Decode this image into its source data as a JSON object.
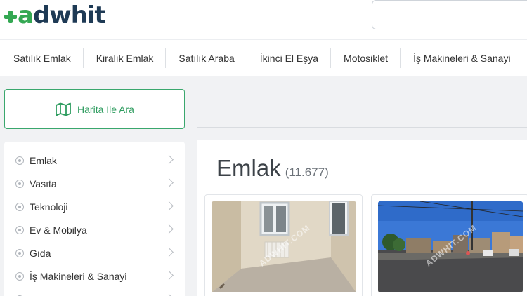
{
  "header": {
    "logo": {
      "accent": "a",
      "rest": "dwhit"
    },
    "search": {
      "placeholder": ""
    }
  },
  "nav": {
    "items": [
      "Satılık Emlak",
      "Kiralık Emlak",
      "Satılık Araba",
      "İkinci El Eşya",
      "Motosiklet",
      "İş Makineleri & Sanayi"
    ]
  },
  "map_button": {
    "label": "Harita Ile Ara",
    "icon": "map-icon"
  },
  "sidebar": {
    "items": [
      {
        "label": "Emlak"
      },
      {
        "label": "Vasıta"
      },
      {
        "label": "Teknoloji"
      },
      {
        "label": "Ev & Mobilya"
      },
      {
        "label": "Gıda"
      },
      {
        "label": "İş Makineleri & Sanayi"
      },
      {
        "label": ""
      }
    ]
  },
  "main": {
    "title": "Emlak",
    "count": "(11.677)",
    "listings": [
      {
        "watermark": "ADWHIT.COM",
        "image": "empty-room-photo"
      },
      {
        "watermark": "ADWHIT.COM",
        "image": "street-photo"
      }
    ]
  },
  "colors": {
    "brand_green": "#34a853",
    "brand_dark": "#1e3a55",
    "accent": "#2e9c5f"
  }
}
